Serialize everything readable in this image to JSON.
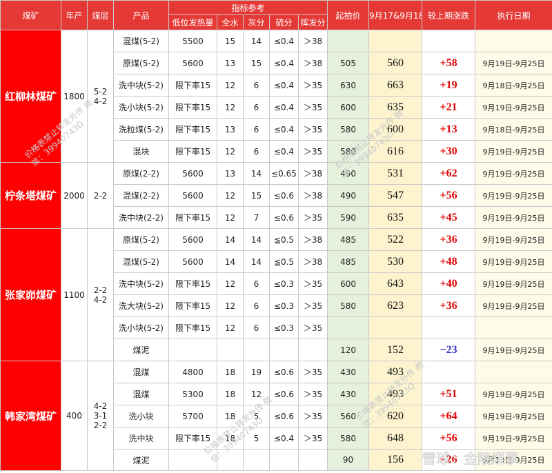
{
  "header": {
    "mine": "煤矿",
    "output": "年产",
    "layer": "煤层",
    "product": "产品",
    "index_ref": "指标参考",
    "calorific": "低位发热量",
    "moisture": "全水",
    "ash": "灰分",
    "sulfur": "硫分",
    "volatile": "挥发分",
    "start_price": "起拍价",
    "date_price": "9月17&9月18",
    "change": "较上期涨跌",
    "exec_date": "执行日期"
  },
  "groups": [
    {
      "mine": "红柳林煤矿",
      "output": "1800",
      "layer": "5-2\n4-2",
      "rows": [
        {
          "product": "混煤(5-2)",
          "calorific": "5500",
          "moisture": "15",
          "ash": "14",
          "sulfur": "≤0.4",
          "volatile": "＞38",
          "start": "",
          "price": "",
          "change": "",
          "dir": "",
          "date": ""
        },
        {
          "product": "原煤(5-2)",
          "calorific": "5600",
          "moisture": "13",
          "ash": "15",
          "sulfur": "≤0.4",
          "volatile": "＞38",
          "start": "505",
          "price": "560",
          "change": "+58",
          "dir": "up",
          "date": "9月19日-9月25日"
        },
        {
          "product": "洗中块(5-2)",
          "calorific": "限下率15",
          "moisture": "12",
          "ash": "6",
          "sulfur": "≤0.4",
          "volatile": "＞35",
          "start": "630",
          "price": "663",
          "change": "+19",
          "dir": "up",
          "date": "9月18日-9月25日"
        },
        {
          "product": "洗小块(5-2)",
          "calorific": "限下率15",
          "moisture": "12",
          "ash": "6",
          "sulfur": "≤0.4",
          "volatile": "＞35",
          "start": "600",
          "price": "635",
          "change": "+21",
          "dir": "up",
          "date": "9月19日-9月25日"
        },
        {
          "product": "洗粒煤(5-2)",
          "calorific": "限下率15",
          "moisture": "13",
          "ash": "6",
          "sulfur": "≤0.4",
          "volatile": "＞35",
          "start": "580",
          "price": "600",
          "change": "+13",
          "dir": "up",
          "date": "9月18日-9月25日"
        },
        {
          "product": "混块",
          "calorific": "限下率15",
          "moisture": "12",
          "ash": "6",
          "sulfur": "≤0.4",
          "volatile": "＞35",
          "start": "580",
          "price": "616",
          "change": "+30",
          "dir": "up",
          "date": "9月19日-9月25日"
        }
      ]
    },
    {
      "mine": "柠条塔煤矿",
      "output": "2000",
      "layer": "2-2",
      "rows": [
        {
          "product": "原煤(2-2)",
          "calorific": "5600",
          "moisture": "13",
          "ash": "14",
          "sulfur": "≤0.65",
          "volatile": "＞38",
          "start": "490",
          "price": "531",
          "change": "+62",
          "dir": "up",
          "date": "9月19日-9月25日"
        },
        {
          "product": "混煤(2-2)",
          "calorific": "5600",
          "moisture": "12",
          "ash": "15",
          "sulfur": "≤0.6",
          "volatile": "＞38",
          "start": "490",
          "price": "547",
          "change": "+56",
          "dir": "up",
          "date": "9月19日-9月25日"
        },
        {
          "product": "洗中块(2-2)",
          "calorific": "限下率15",
          "moisture": "12",
          "ash": "7",
          "sulfur": "≤0.6",
          "volatile": "＞35",
          "start": "590",
          "price": "635",
          "change": "+45",
          "dir": "up",
          "date": "9月19日-9月25日"
        }
      ]
    },
    {
      "mine": "张家峁煤矿",
      "output": "1100",
      "layer": "2-2\n4-2",
      "rows": [
        {
          "product": "原煤(5-2)",
          "calorific": "5600",
          "moisture": "14",
          "ash": "14",
          "sulfur": "≦0.5",
          "volatile": "＞38",
          "start": "485",
          "price": "522",
          "change": "+36",
          "dir": "up",
          "date": "9月19日-9月25日"
        },
        {
          "product": "混煤(5-2)",
          "calorific": "5600",
          "moisture": "14",
          "ash": "14",
          "sulfur": "≦0.5",
          "volatile": "＞38",
          "start": "485",
          "price": "530",
          "change": "+48",
          "dir": "up",
          "date": "9月19日-9月25日"
        },
        {
          "product": "洗中块(5-2)",
          "calorific": "限下率15",
          "moisture": "12",
          "ash": "6",
          "sulfur": "≤0.3",
          "volatile": "＞35",
          "start": "600",
          "price": "643",
          "change": "+40",
          "dir": "up",
          "date": "9月19日-9月25日"
        },
        {
          "product": "洗大块(5-2)",
          "calorific": "限下率15",
          "moisture": "12",
          "ash": "6",
          "sulfur": "≤0.3",
          "volatile": "＞35",
          "start": "580",
          "price": "623",
          "change": "+36",
          "dir": "up",
          "date": "9月19日-9月25日"
        },
        {
          "product": "洗小块(5-2)",
          "calorific": "限下率15",
          "moisture": "12",
          "ash": "6",
          "sulfur": "≤0.3",
          "volatile": "＞35",
          "start": "",
          "price": "",
          "change": "",
          "dir": "",
          "date": ""
        },
        {
          "product": "煤泥",
          "calorific": "",
          "moisture": "",
          "ash": "",
          "sulfur": "",
          "volatile": "",
          "start": "120",
          "price": "152",
          "change": "−23",
          "dir": "down",
          "date": "9月19日-9月25日"
        }
      ]
    },
    {
      "mine": "韩家湾煤矿",
      "output": "400",
      "layer": "4-2\n3-1\n2-2",
      "rows": [
        {
          "product": "混煤",
          "calorific": "4800",
          "moisture": "18",
          "ash": "19",
          "sulfur": "≤0.6",
          "volatile": "＞35",
          "start": "430",
          "price": "493",
          "change": "",
          "dir": "",
          "date": ""
        },
        {
          "product": "混煤",
          "calorific": "5300",
          "moisture": "18",
          "ash": "12",
          "sulfur": "≤0.6",
          "volatile": "＞35",
          "start": "430",
          "price": "493",
          "change": "+51",
          "dir": "up",
          "date": "9月19日-9月25日"
        },
        {
          "product": "洗小块",
          "calorific": "5700",
          "moisture": "18",
          "ash": "5",
          "sulfur": "≤0.6",
          "volatile": "＞35",
          "start": "560",
          "price": "620",
          "change": "+64",
          "dir": "up",
          "date": "9月19日-9月25日"
        },
        {
          "product": "洗中块",
          "calorific": "限下率15",
          "moisture": "18",
          "ash": "5",
          "sulfur": "≤0.4",
          "volatile": "＞35",
          "start": "580",
          "price": "648",
          "change": "+56",
          "dir": "up",
          "date": "9月19日-9月25日"
        },
        {
          "product": "煤泥",
          "calorific": "",
          "moisture": "",
          "ash": "",
          "sulfur": "",
          "volatile": "",
          "start": "90",
          "price": "156",
          "change": "+26",
          "dir": "up",
          "date": "9月19日-9月25日"
        }
      ]
    }
  ],
  "watermark": {
    "lines": [
      "价格表禁止转发外传 微",
      "信：39940743O"
    ],
    "brand": "雪球：金陵煤事",
    "color": "#c9c9c9"
  }
}
